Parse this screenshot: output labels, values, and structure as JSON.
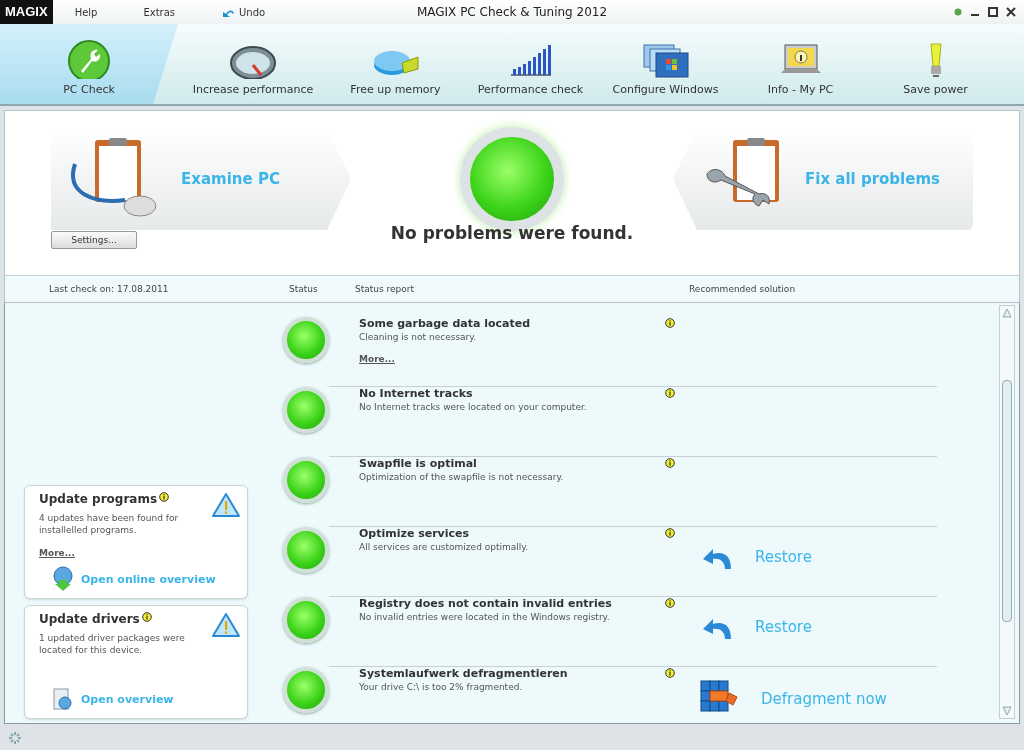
{
  "window": {
    "logo": "MAGIX",
    "title": "MAGIX PC Check & Tuning 2012",
    "menu": [
      {
        "label": "Help",
        "kind": "text"
      },
      {
        "label": "Extras",
        "kind": "text"
      },
      {
        "label": "Undo",
        "kind": "undo"
      }
    ]
  },
  "tabs": [
    {
      "label": "PC Check",
      "selected": true
    },
    {
      "label": "Increase performance",
      "selected": false
    },
    {
      "label": "Free up memory",
      "selected": false
    },
    {
      "label": "Performance check",
      "selected": false
    },
    {
      "label": "Configure Windows",
      "selected": false
    },
    {
      "label": "Info - My PC",
      "selected": false
    },
    {
      "label": "Save power",
      "selected": false
    }
  ],
  "check": {
    "examine_label": "Examine PC",
    "fix_label": "Fix all problems",
    "message": "No problems were found.",
    "settings_label": "Settings..."
  },
  "columns": {
    "last_check": "Last check on: 17.08.2011",
    "status": "Status",
    "report": "Status report",
    "solution": "Recommended solution"
  },
  "updates": [
    {
      "title": "Update programs",
      "text": "4 updates have been found for installelled programs.",
      "more": "More...",
      "action": "Open online overview",
      "kind": "online"
    },
    {
      "title": "Update drivers",
      "text": "1 updated driver packages were located for this device.",
      "action": "Open overview",
      "kind": "drivers"
    }
  ],
  "rows": [
    {
      "title": "Some garbage data located",
      "text": "Cleaning is not necessary.",
      "more": "More..."
    },
    {
      "title": "No Internet tracks",
      "text": "No Internet tracks were located on your computer."
    },
    {
      "title": "Swapfile is optimal",
      "text": "Optimization of the swapfile is not necessary."
    },
    {
      "title": "Optimize services",
      "text": "All services are customized optimally.",
      "solution": {
        "kind": "restore",
        "label": "Restore"
      }
    },
    {
      "title": "Registry does not contain invalid entries",
      "text": "No invalid entries were located in the Windows registry.",
      "solution": {
        "kind": "restore",
        "label": "Restore"
      }
    },
    {
      "title": "Systemlaufwerk defragmentieren",
      "text": "Your drive C:\\ is too 2% fragmented.",
      "solution": {
        "kind": "defrag",
        "label": "Defragment now"
      }
    }
  ]
}
